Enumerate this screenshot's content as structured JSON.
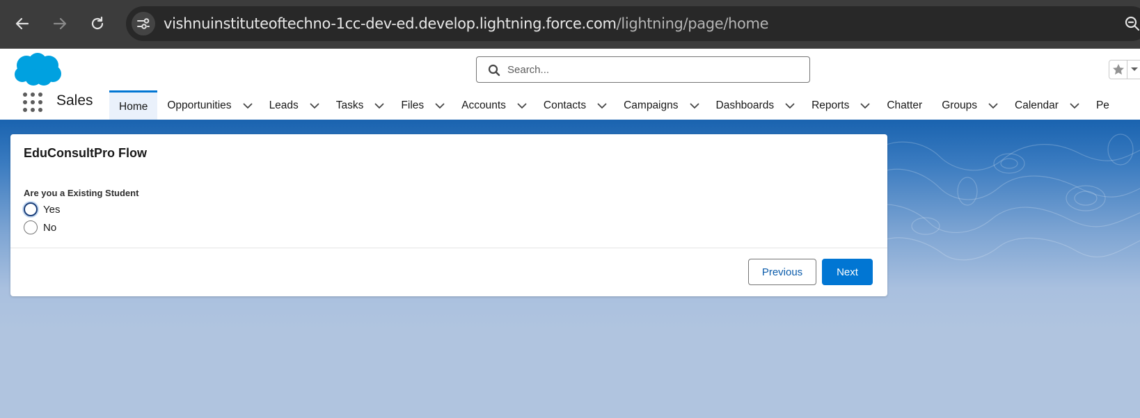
{
  "browser": {
    "url_host": "vishnuinstituteoftechno-1cc-dev-ed.develop.lightning.force.com",
    "url_path": "/lightning/page/home",
    "icons": [
      "back-arrow-icon",
      "forward-arrow-icon",
      "reload-icon",
      "site-info-icon",
      "zoom-icon"
    ]
  },
  "header": {
    "search_placeholder": "Search...",
    "app_name": "Sales"
  },
  "nav": {
    "items": [
      {
        "label": "Home",
        "active": true,
        "has_menu": false
      },
      {
        "label": "Opportunities",
        "has_menu": true
      },
      {
        "label": "Leads",
        "has_menu": true
      },
      {
        "label": "Tasks",
        "has_menu": true
      },
      {
        "label": "Files",
        "has_menu": true
      },
      {
        "label": "Accounts",
        "has_menu": true
      },
      {
        "label": "Contacts",
        "has_menu": true
      },
      {
        "label": "Campaigns",
        "has_menu": true
      },
      {
        "label": "Dashboards",
        "has_menu": true
      },
      {
        "label": "Reports",
        "has_menu": true
      },
      {
        "label": "Chatter",
        "has_menu": false
      },
      {
        "label": "Groups",
        "has_menu": true
      },
      {
        "label": "Calendar",
        "has_menu": true
      },
      {
        "label": "Pe",
        "has_menu": false
      }
    ]
  },
  "flow": {
    "title": "EduConsultPro Flow",
    "question": "Are you a Existing Student",
    "options": [
      "Yes",
      "No"
    ],
    "previous_label": "Previous",
    "next_label": "Next"
  },
  "colors": {
    "brand_blue": "#0176d3",
    "salesforce_cloud": "#00a1e0",
    "header_band": "#1b64b0"
  }
}
